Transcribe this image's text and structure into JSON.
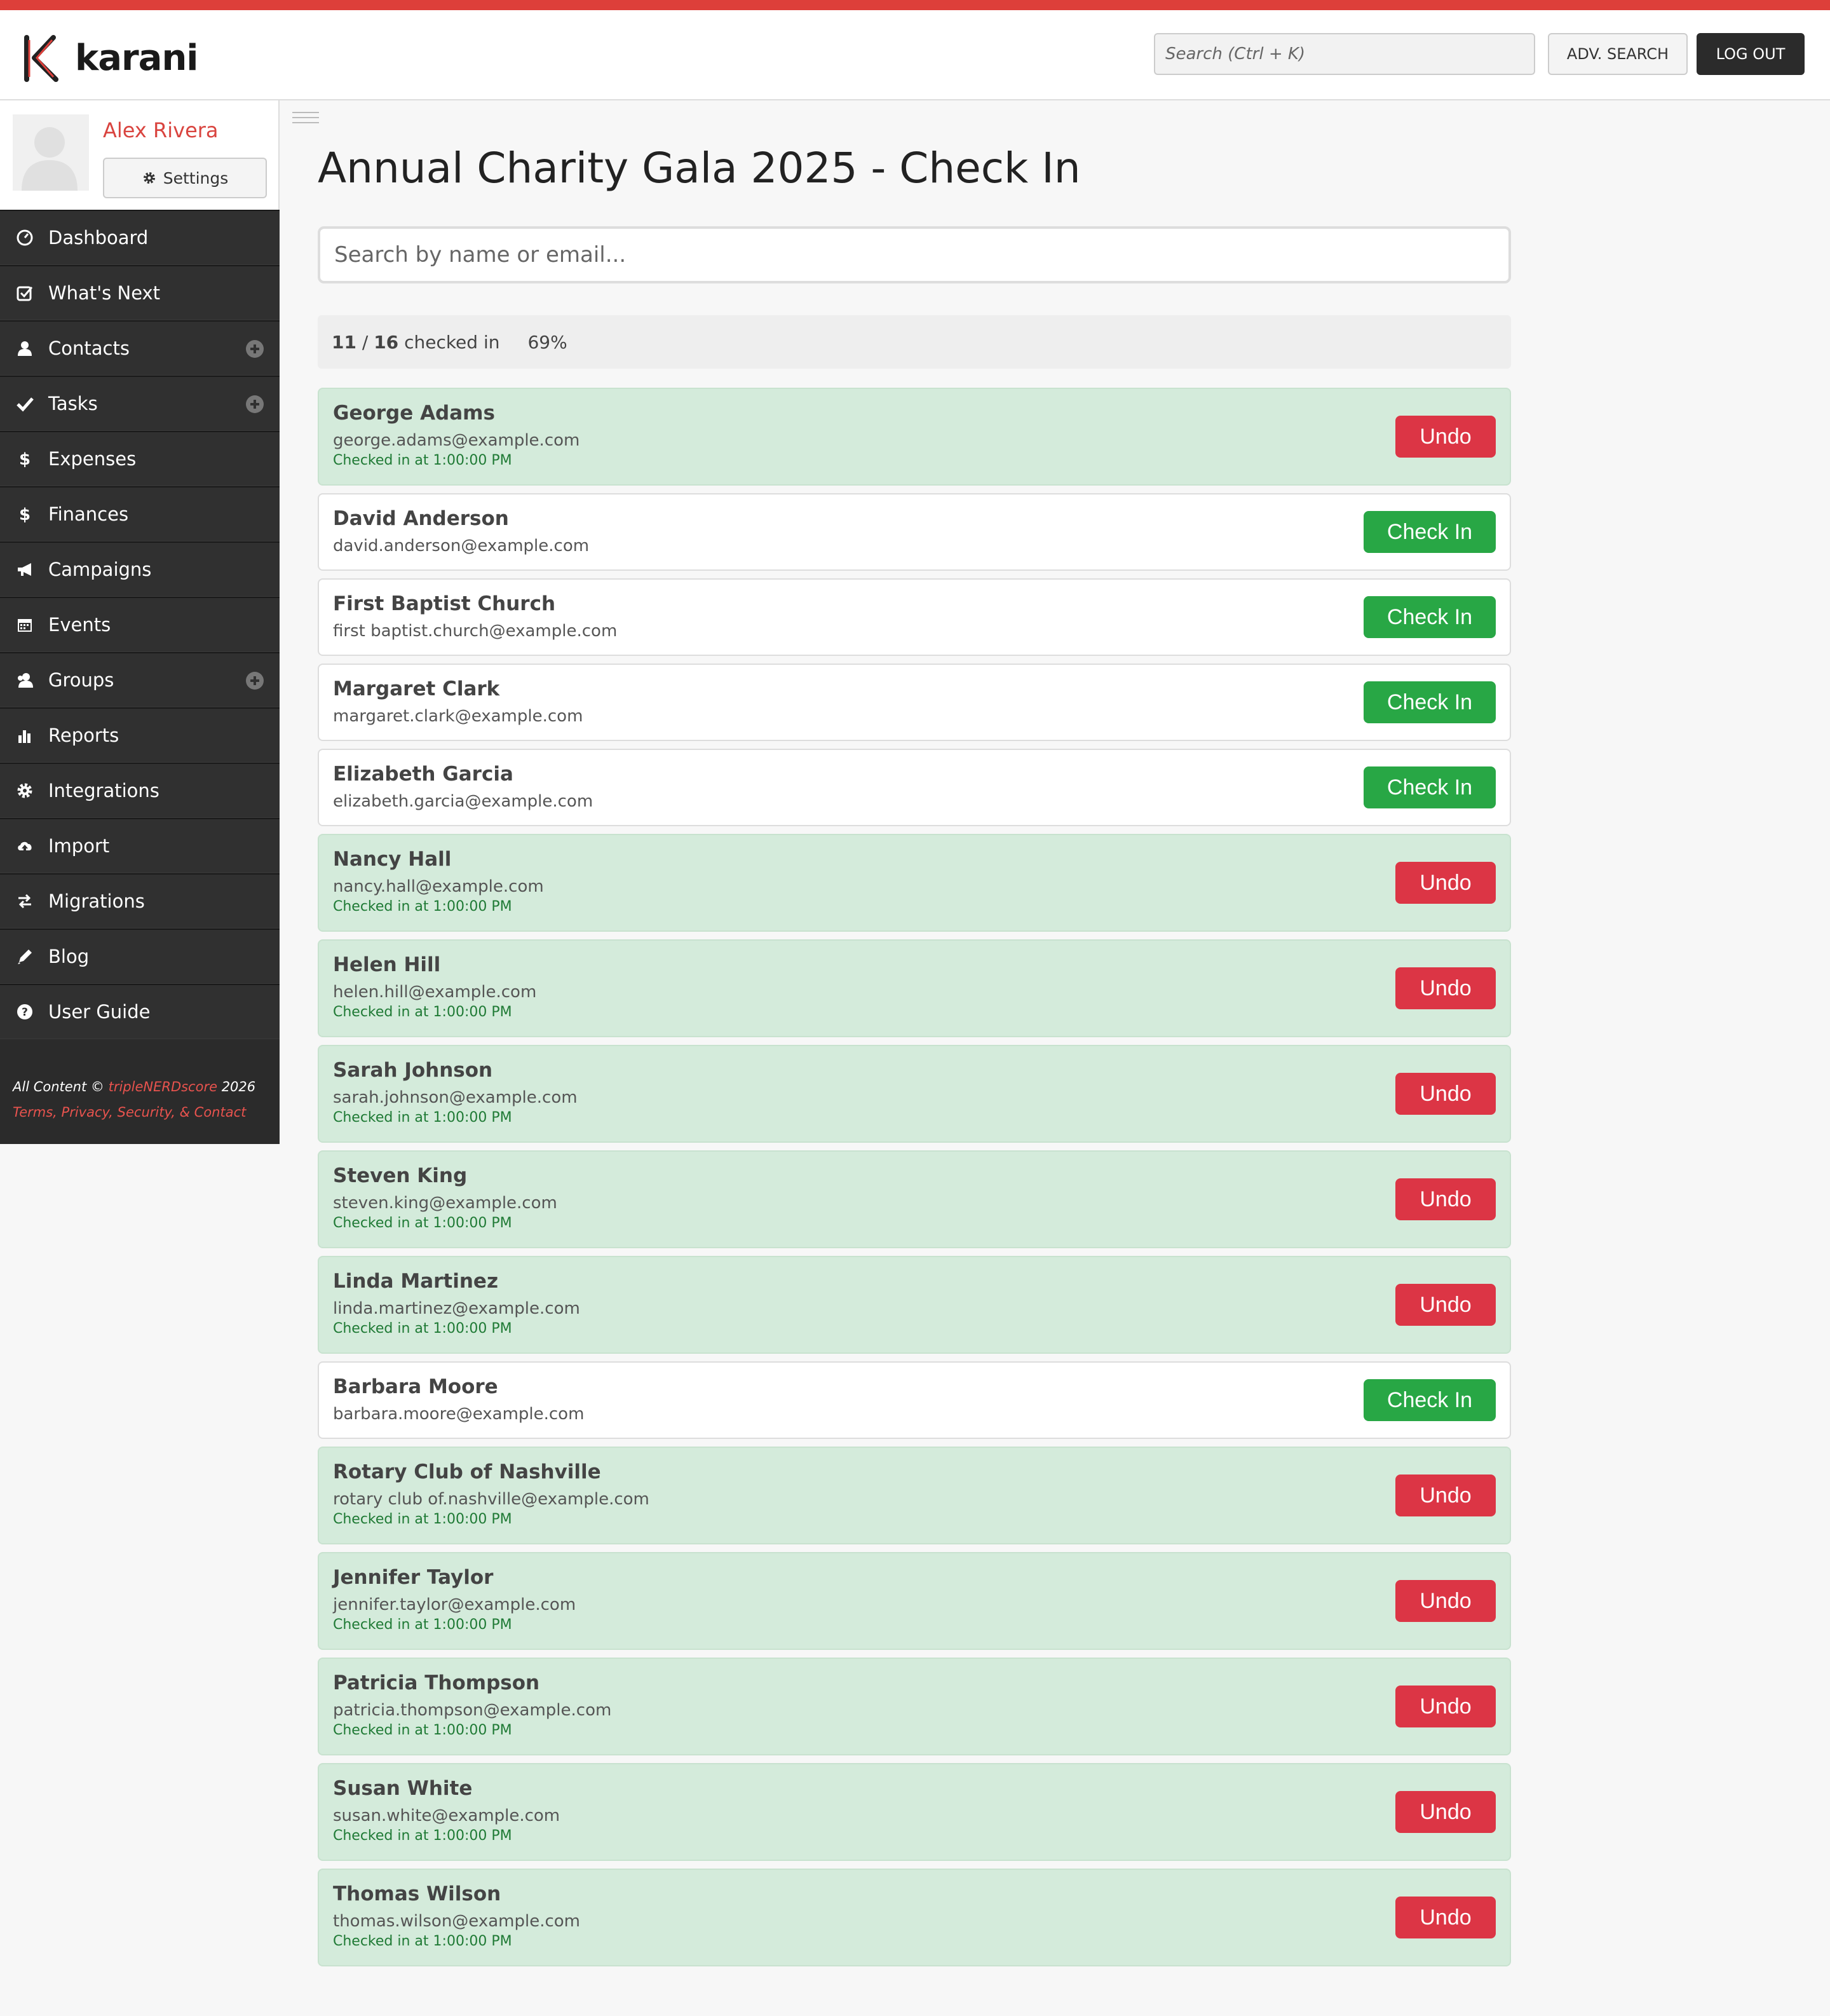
{
  "header": {
    "logo_text": "karani",
    "search_placeholder": "Search (Ctrl + K)",
    "adv_search_label": "ADV. SEARCH",
    "logout_label": "LOG OUT"
  },
  "profile": {
    "name": "Alex Rivera",
    "settings_label": "Settings"
  },
  "nav": [
    {
      "label": "Dashboard",
      "icon": "dashboard-icon"
    },
    {
      "label": "What's Next",
      "icon": "check-square-icon"
    },
    {
      "label": "Contacts",
      "icon": "user-icon",
      "add": true
    },
    {
      "label": "Tasks",
      "icon": "checkmark-icon",
      "add": true
    },
    {
      "label": "Expenses",
      "icon": "dollar-icon"
    },
    {
      "label": "Finances",
      "icon": "dollar-icon"
    },
    {
      "label": "Campaigns",
      "icon": "megaphone-icon"
    },
    {
      "label": "Events",
      "icon": "calendar-icon"
    },
    {
      "label": "Groups",
      "icon": "group-icon",
      "add": true
    },
    {
      "label": "Reports",
      "icon": "bar-chart-icon"
    },
    {
      "label": "Integrations",
      "icon": "gear-icon"
    },
    {
      "label": "Import",
      "icon": "cloud-upload-icon"
    },
    {
      "label": "Migrations",
      "icon": "exchange-icon"
    },
    {
      "label": "Blog",
      "icon": "pencil-icon"
    },
    {
      "label": "User Guide",
      "icon": "question-icon"
    }
  ],
  "footer": {
    "prefix": "All Content © ",
    "brand": "tripleNERDscore",
    "year": " 2026",
    "links": "Terms, Privacy, Security, & Contact"
  },
  "page": {
    "title": "Annual Charity Gala 2025 - Check In",
    "search_placeholder": "Search by name or email...",
    "checked_count": "11",
    "separator": " / ",
    "total_count": "16",
    "checked_suffix": " checked in",
    "percent": "69%"
  },
  "buttons": {
    "undo": "Undo",
    "check_in": "Check In"
  },
  "guests": [
    {
      "name": "George Adams",
      "email": "george.adams@example.com",
      "checked": true,
      "time": "Checked in at 1:00:00 PM"
    },
    {
      "name": "David Anderson",
      "email": "david.anderson@example.com",
      "checked": false
    },
    {
      "name": "First Baptist Church",
      "email": "first baptist.church@example.com",
      "checked": false
    },
    {
      "name": "Margaret Clark",
      "email": "margaret.clark@example.com",
      "checked": false
    },
    {
      "name": "Elizabeth Garcia",
      "email": "elizabeth.garcia@example.com",
      "checked": false
    },
    {
      "name": "Nancy Hall",
      "email": "nancy.hall@example.com",
      "checked": true,
      "time": "Checked in at 1:00:00 PM"
    },
    {
      "name": "Helen Hill",
      "email": "helen.hill@example.com",
      "checked": true,
      "time": "Checked in at 1:00:00 PM"
    },
    {
      "name": "Sarah Johnson",
      "email": "sarah.johnson@example.com",
      "checked": true,
      "time": "Checked in at 1:00:00 PM"
    },
    {
      "name": "Steven King",
      "email": "steven.king@example.com",
      "checked": true,
      "time": "Checked in at 1:00:00 PM"
    },
    {
      "name": "Linda Martinez",
      "email": "linda.martinez@example.com",
      "checked": true,
      "time": "Checked in at 1:00:00 PM"
    },
    {
      "name": "Barbara Moore",
      "email": "barbara.moore@example.com",
      "checked": false
    },
    {
      "name": "Rotary Club of Nashville",
      "email": "rotary club of.nashville@example.com",
      "checked": true,
      "time": "Checked in at 1:00:00 PM"
    },
    {
      "name": "Jennifer Taylor",
      "email": "jennifer.taylor@example.com",
      "checked": true,
      "time": "Checked in at 1:00:00 PM"
    },
    {
      "name": "Patricia Thompson",
      "email": "patricia.thompson@example.com",
      "checked": true,
      "time": "Checked in at 1:00:00 PM"
    },
    {
      "name": "Susan White",
      "email": "susan.white@example.com",
      "checked": true,
      "time": "Checked in at 1:00:00 PM"
    },
    {
      "name": "Thomas Wilson",
      "email": "thomas.wilson@example.com",
      "checked": true,
      "time": "Checked in at 1:00:00 PM"
    }
  ],
  "colors": {
    "brand_red": "#dd3f3a",
    "sidebar_bg": "#2b2b2b",
    "checked_row": "#d4ebdb",
    "undo": "#dc3545",
    "check_in": "#28a745"
  }
}
